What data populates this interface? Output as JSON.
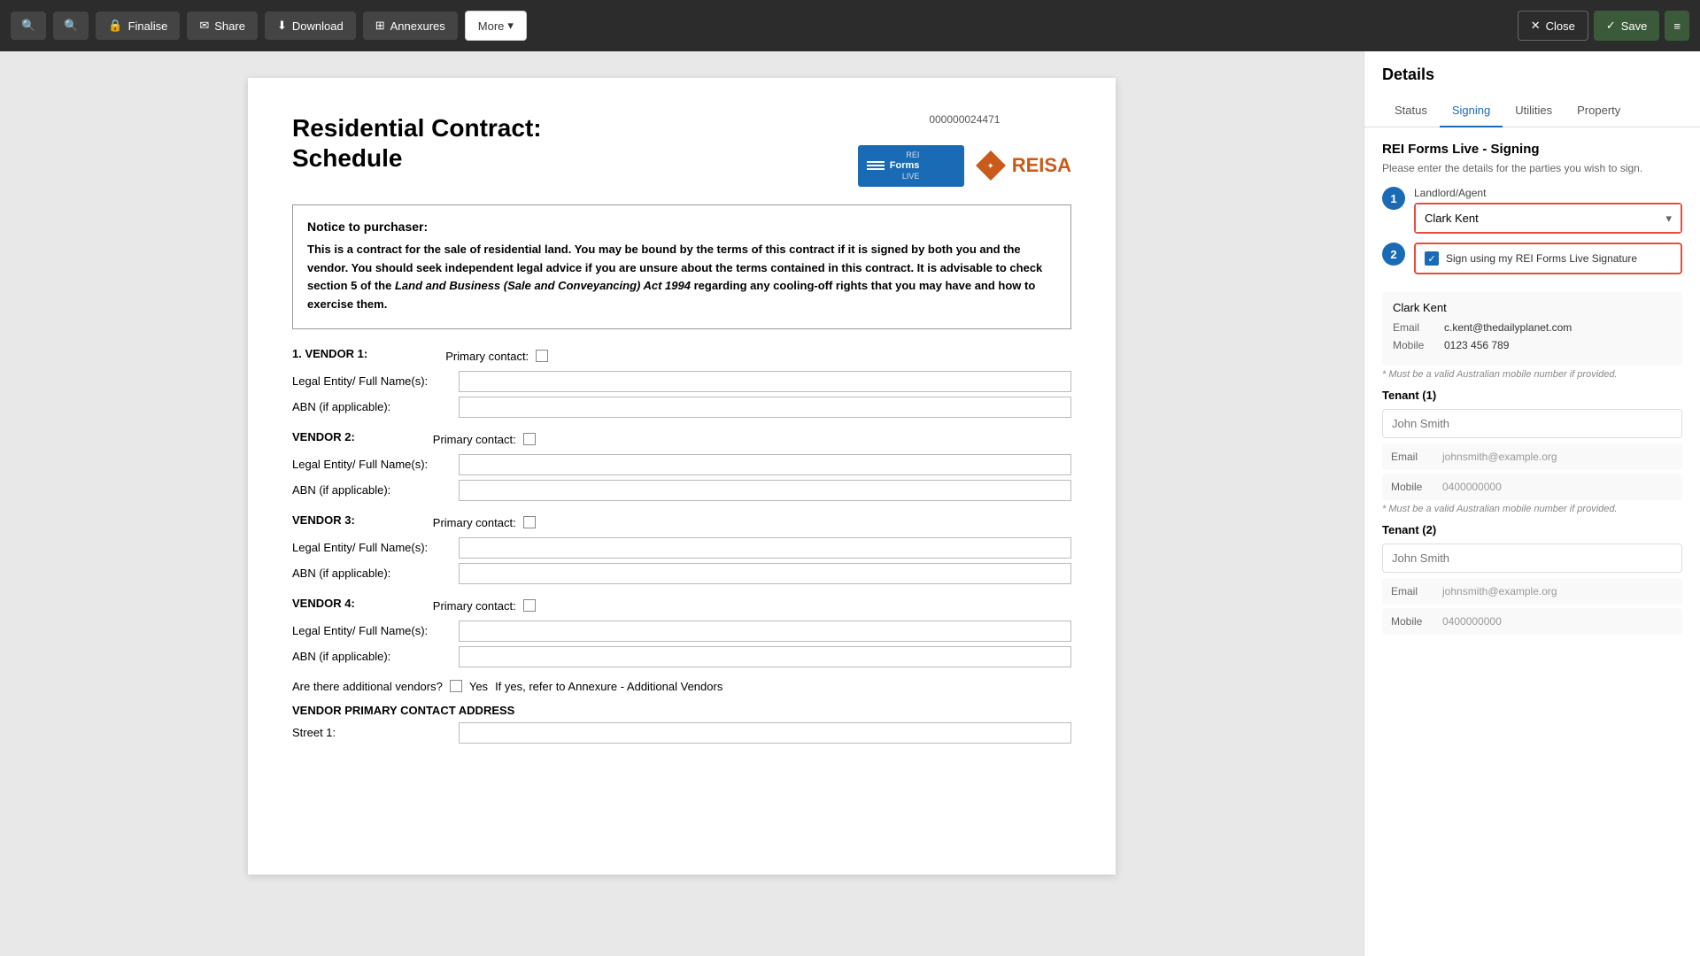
{
  "toolbar": {
    "search1_label": "",
    "search2_label": "",
    "finalise_label": "Finalise",
    "share_label": "Share",
    "download_label": "Download",
    "annexures_label": "Annexures",
    "more_label": "More",
    "close_label": "Close",
    "save_label": "Save"
  },
  "document": {
    "id": "000000024471",
    "title_line1": "Residential Contract:",
    "title_line2": "Schedule",
    "notice": {
      "title": "Notice to purchaser:",
      "body_part1": "This is a contract for the sale of residential land. You may be bound by the terms of this contract if it is signed by both you and the vendor. You should seek independent legal advice if you are unsure about the terms contained in this contract.  It is advisable to check section 5 of the ",
      "body_italic": "Land and Business (Sale and Conveyancing) Act 1994",
      "body_part2": " regarding any cooling-off rights that you may have and how to exercise them."
    },
    "vendors": [
      {
        "num": "1",
        "title": "VENDOR 1:",
        "primary_contact_label": "Primary contact:"
      },
      {
        "num": "2",
        "title": "VENDOR 2:",
        "primary_contact_label": "Primary contact:"
      },
      {
        "num": "3",
        "title": "VENDOR 3:",
        "primary_contact_label": "Primary contact:"
      },
      {
        "num": "4",
        "title": "VENDOR 4:",
        "primary_contact_label": "Primary contact:"
      }
    ],
    "legal_entity_label": "Legal Entity/ Full Name(s):",
    "abn_label": "ABN (if applicable):",
    "additional_vendors_question": "Are there additional vendors?",
    "additional_vendors_yes": "Yes",
    "additional_vendors_note": "If yes, refer to Annexure - Additional Vendors",
    "vendor_primary_contact_address": "VENDOR PRIMARY CONTACT ADDRESS",
    "street1_label": "Street 1:"
  },
  "sidebar": {
    "title": "Details",
    "tabs": [
      {
        "id": "status",
        "label": "Status"
      },
      {
        "id": "signing",
        "label": "Signing",
        "active": true
      },
      {
        "id": "utilities",
        "label": "Utilities"
      },
      {
        "id": "property",
        "label": "Property"
      }
    ],
    "signing": {
      "title": "REI Forms Live - Signing",
      "subtitle": "Please enter the details for the parties you wish to sign.",
      "badge1": "1",
      "badge2": "2",
      "landlord_agent_label": "Landlord/Agent",
      "landlord_agent_value": "Clark Kent",
      "landlord_agent_options": [
        "Clark Kent"
      ],
      "checkbox_label": "Sign using my REI Forms Live Signature",
      "clark_kent_card": {
        "name": "Clark Kent",
        "email_label": "Email",
        "email_value": "c.kent@thedailyplanet.com",
        "mobile_label": "Mobile",
        "mobile_value": "0123 456 789",
        "hint": "* Must be a valid Australian mobile number if provided."
      },
      "tenant1": {
        "title": "Tenant (1)",
        "name_placeholder": "John Smith",
        "email_label": "Email",
        "email_placeholder": "johnsmith@example.org",
        "mobile_label": "Mobile",
        "mobile_placeholder": "0400000000",
        "hint": "* Must be a valid Australian mobile number if provided."
      },
      "tenant2": {
        "title": "Tenant (2)",
        "name_placeholder": "John Smith",
        "email_label": "Email",
        "email_placeholder": "johnsmith@example.org",
        "mobile_label": "Mobile",
        "mobile_placeholder": "0400000000"
      }
    }
  },
  "logos": {
    "rei_forms_live": "REI Forms LIVE",
    "reisa": "REISA",
    "doc_id": "000000024471"
  }
}
